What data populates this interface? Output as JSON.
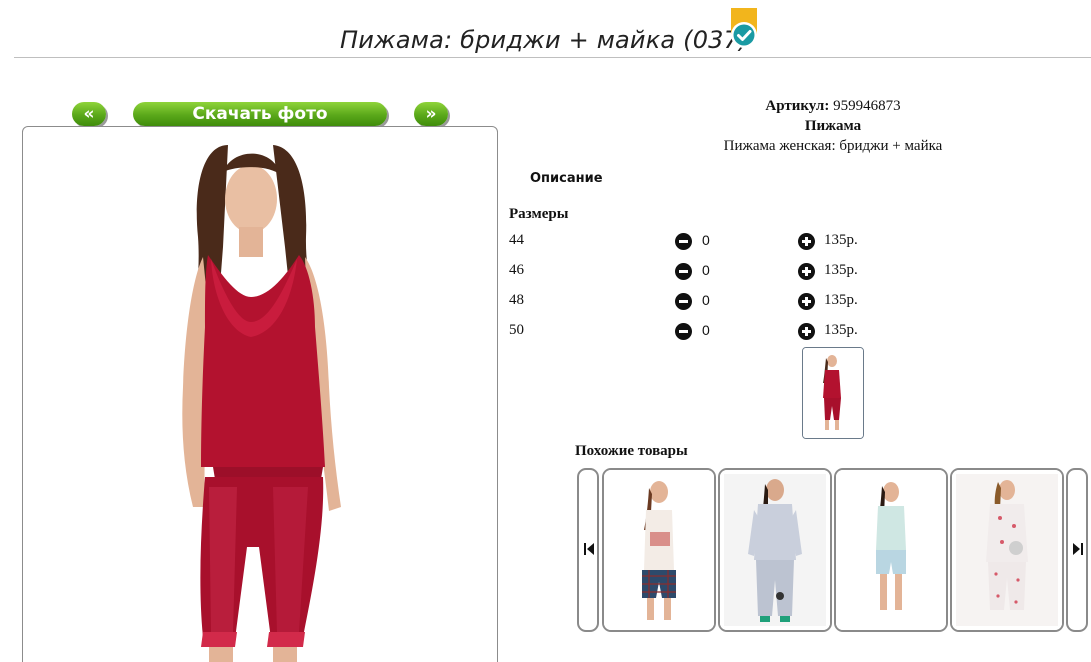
{
  "header": {
    "title": "Пижама: бриджи + майка (037)",
    "badge_icon": "verified-check-icon"
  },
  "gallery": {
    "prev_label": "«",
    "next_label": "»",
    "download_label": "Скачать фото"
  },
  "product": {
    "sku_label": "Артикул:",
    "sku_value": "959946873",
    "name": "Пижама",
    "description": "Пижама женская: бриджи + майка"
  },
  "tabs": {
    "description_label": "Описание"
  },
  "sizes": {
    "title": "Размеры",
    "rows": [
      {
        "size": "44",
        "qty": "0",
        "price": "135р."
      },
      {
        "size": "46",
        "qty": "0",
        "price": "135р."
      },
      {
        "size": "48",
        "qty": "0",
        "price": "135р."
      },
      {
        "size": "50",
        "qty": "0",
        "price": "135р."
      }
    ]
  },
  "similar": {
    "title": "Похожие товары",
    "items": [
      {
        "icon": "pajama-tank-plaid-shorts-photo"
      },
      {
        "icon": "pajama-grey-long-photo"
      },
      {
        "icon": "pajama-mint-shorts-photo"
      },
      {
        "icon": "pajama-print-capri-photo"
      }
    ]
  },
  "colors": {
    "accent_green": "#5aa81a",
    "product_red": "#b3122f"
  }
}
